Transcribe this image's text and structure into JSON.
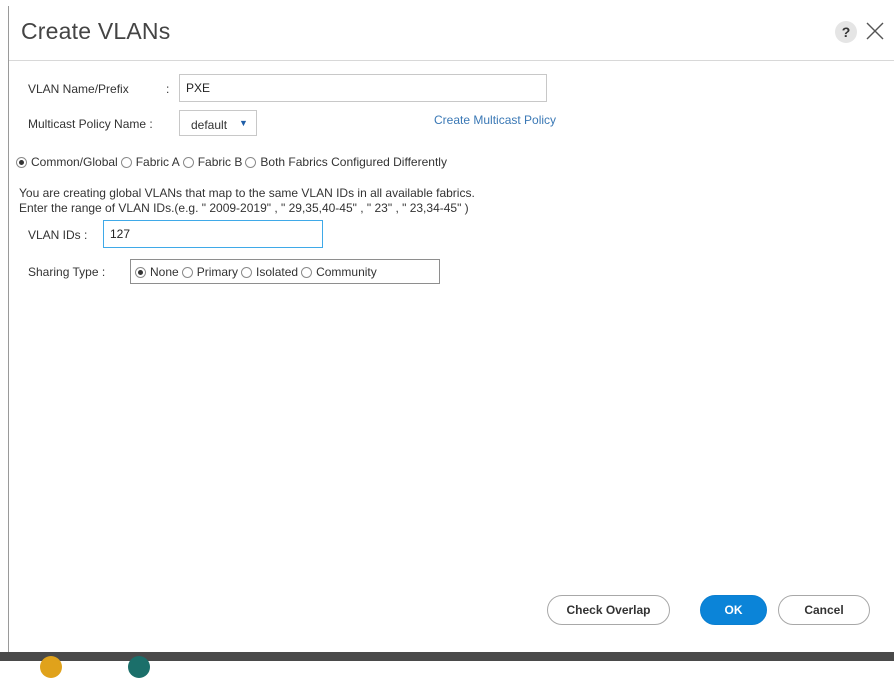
{
  "dialog": {
    "title": "Create VLANs",
    "help_label": "?"
  },
  "form": {
    "vlan_name_label": "VLAN Name/Prefix",
    "vlan_name_sep": ":",
    "vlan_name_value": "PXE",
    "multicast_label": "Multicast Policy Name :",
    "multicast_selected": "default",
    "create_multicast_link": "Create Multicast Policy",
    "fabric_options": [
      {
        "label": "Common/Global",
        "checked": true
      },
      {
        "label": "Fabric A",
        "checked": false
      },
      {
        "label": "Fabric B",
        "checked": false
      },
      {
        "label": "Both Fabrics Configured Differently",
        "checked": false
      }
    ],
    "info_line1": "You are creating global VLANs that map to the same VLAN IDs in all available fabrics.",
    "info_line2": "Enter the range of VLAN IDs.(e.g. \" 2009-2019\" , \" 29,35,40-45\" , \" 23\" , \" 23,34-45\" )",
    "vlan_ids_label": "VLAN IDs :",
    "vlan_ids_value": "127",
    "sharing_label": "Sharing Type :",
    "sharing_options": [
      {
        "label": "None",
        "checked": true
      },
      {
        "label": "Primary",
        "checked": false
      },
      {
        "label": "Isolated",
        "checked": false
      },
      {
        "label": "Community",
        "checked": false
      }
    ]
  },
  "footer": {
    "check_overlap": "Check Overlap",
    "ok": "OK",
    "cancel": "Cancel"
  },
  "colors": {
    "primary_button": "#0b84d8",
    "link": "#3a78b5",
    "focus_border": "#3fa9e8"
  },
  "icons": {
    "help": "help-icon",
    "close": "close-icon",
    "dropdown": "chevron-down-icon"
  }
}
